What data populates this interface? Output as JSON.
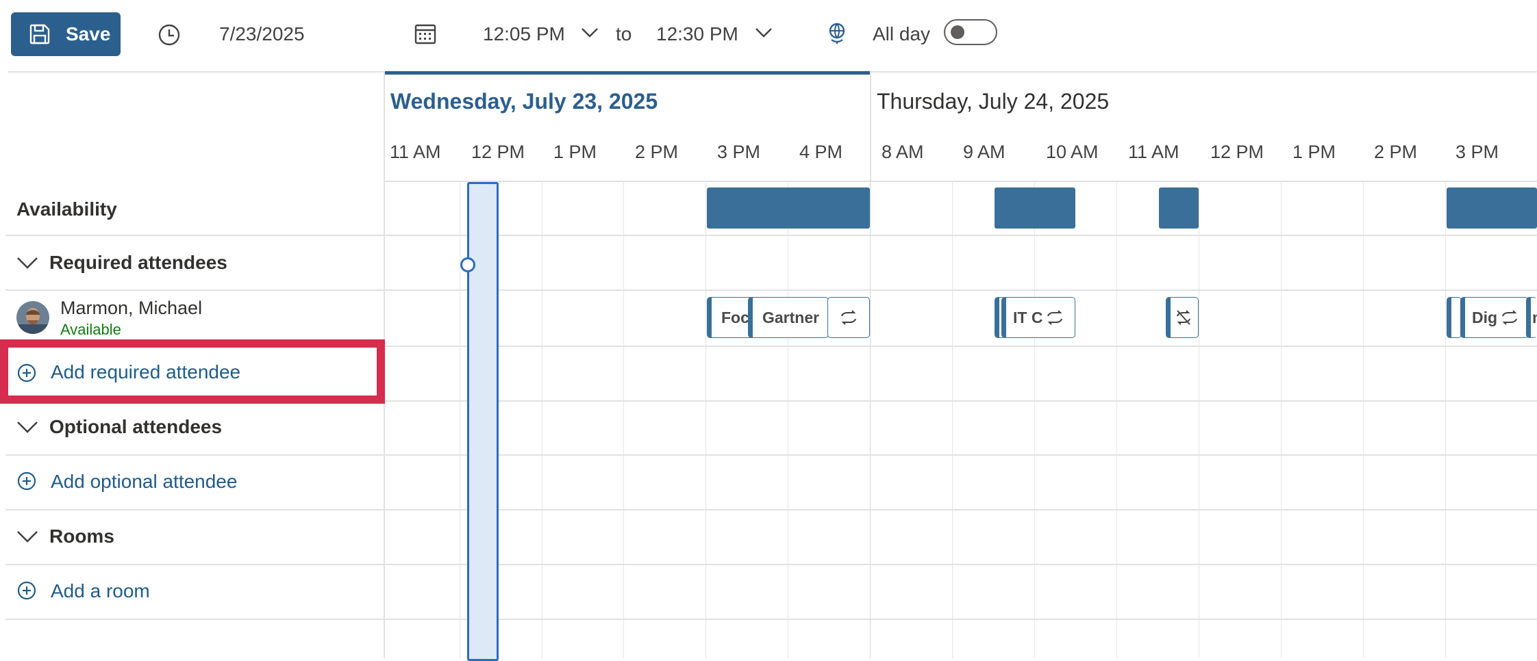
{
  "toolbar": {
    "save_label": "Save",
    "date": "7/23/2025",
    "start_time": "12:05 PM",
    "to_label": "to",
    "end_time": "12:30 PM",
    "all_day_label": "All day",
    "all_day_on": false
  },
  "days": [
    {
      "label": "Wednesday, July 23, 2025",
      "selected": true
    },
    {
      "label": "Thursday, July 24, 2025",
      "selected": false
    }
  ],
  "hours_day1": [
    "11 AM",
    "12 PM",
    "1 PM",
    "2 PM",
    "3 PM",
    "4 PM"
  ],
  "hours_day2": [
    "8 AM",
    "9 AM",
    "10 AM",
    "11 AM",
    "12 PM",
    "1 PM",
    "2 PM",
    "3 PM"
  ],
  "left": {
    "availability": "Availability",
    "required_header": "Required attendees",
    "attendee": {
      "name": "Marmon, Michael",
      "status": "Available"
    },
    "add_required": "Add required attendee",
    "optional_header": "Optional attendees",
    "add_optional": "Add optional attendee",
    "rooms_header": "Rooms",
    "add_room": "Add a room"
  },
  "events": {
    "e1": "Foc",
    "e2": "Gartner",
    "e3": "IT C",
    "e4": "Dig",
    "e4_tail": "m"
  },
  "colors": {
    "brand": "#2b5f8e",
    "busy": "#3a6f99",
    "selection": "#2a6cc4",
    "highlight": "#d52d4e",
    "available": "#107c10"
  }
}
